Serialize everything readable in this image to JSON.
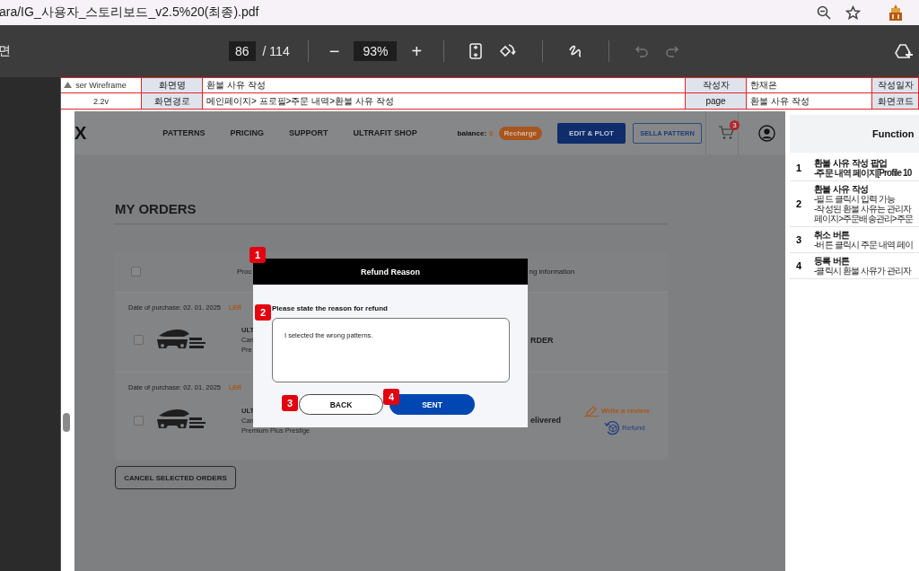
{
  "address_bar": {
    "url": "ara/IG_사용자_스토리보드_v2.5%20(최종).pdf"
  },
  "pdf_toolbar": {
    "title_fragment": "면",
    "page": "86",
    "page_total": "/ 114",
    "zoom_out": "−",
    "zoom": "93%",
    "zoom_in": "+",
    "undo_disabled": true,
    "redo_disabled": true
  },
  "doc_header": {
    "rows": [
      {
        "cells": [
          "ser Wireframe",
          "화면명",
          "환불 사유 작성",
          "작성자",
          "한재은",
          "작성일자"
        ]
      },
      {
        "cells": [
          "2.2v",
          "화면경로",
          "메인페이지> 프로필>주문 내역>환불 사유 작성",
          "page",
          "환불 사유 작성",
          "화면코드"
        ]
      }
    ]
  },
  "site": {
    "logo": "X",
    "nav": [
      "PATTERNS",
      "PRICING",
      "SUPPORT",
      "ULTRAFIT SHOP"
    ],
    "balance_label": "balance:",
    "balance": "0",
    "recharge": "Recharge",
    "edit_plot": "EDIT & PLOT",
    "sella_pattern": "SELLA PATTERN",
    "cart_count": "3"
  },
  "orders": {
    "title": "MY ORDERS",
    "select_all": {
      "checked": false
    },
    "header_left": "Proc",
    "header_right": "ng information",
    "rows": [
      {
        "date": "Date of purchase: 02. 01. 2025",
        "brand": "LER",
        "checked": false,
        "lines": [
          "ULT",
          "Can",
          "Pre"
        ],
        "status": "RDER",
        "actions": []
      },
      {
        "date": "Date of purchase: 02. 01. 2025",
        "brand": "LER",
        "checked": false,
        "lines": [
          "ULT",
          "Can",
          "Premium Plus Prestige"
        ],
        "status": "elivered",
        "actions": [
          {
            "kind": "review",
            "label": "Write a review"
          },
          {
            "kind": "refund",
            "label": "Refund"
          }
        ]
      }
    ],
    "cancel_button": "CANCEL SELECTED ORDERS"
  },
  "modal": {
    "title": "Refund Reason",
    "prompt": "Please state the reason for refund",
    "reason": "I selected the wrong patterns.",
    "back": "BACK",
    "send": "SENT"
  },
  "markers": [
    "1",
    "2",
    "3",
    "4"
  ],
  "function_panel": {
    "title": "Function",
    "items": [
      {
        "number": "1",
        "title": "환불 사유 작성 팝업",
        "lines": [
          {
            "text": "-주문 내역 페이지[Profile 10",
            "bold": true
          }
        ]
      },
      {
        "number": "2",
        "title": "환불 사유 작성",
        "lines": [
          {
            "text": "-필드 클릭시 입력 가능",
            "bold": false
          },
          {
            "text": "-작성된 환불 사유는 관리자",
            "bold": false
          },
          {
            "text": "페이지>주문배송관리>주문",
            "bold": false
          }
        ]
      },
      {
        "number": "3",
        "title": "취소 버튼",
        "lines": [
          {
            "text": "-버튼 클릭시 주문 내역 페이",
            "bold": false
          }
        ]
      },
      {
        "number": "4",
        "title": "등록 버튼",
        "lines": [
          {
            "text": "-클릭시 환불 사유가 관리자",
            "bold": false
          }
        ]
      }
    ]
  }
}
